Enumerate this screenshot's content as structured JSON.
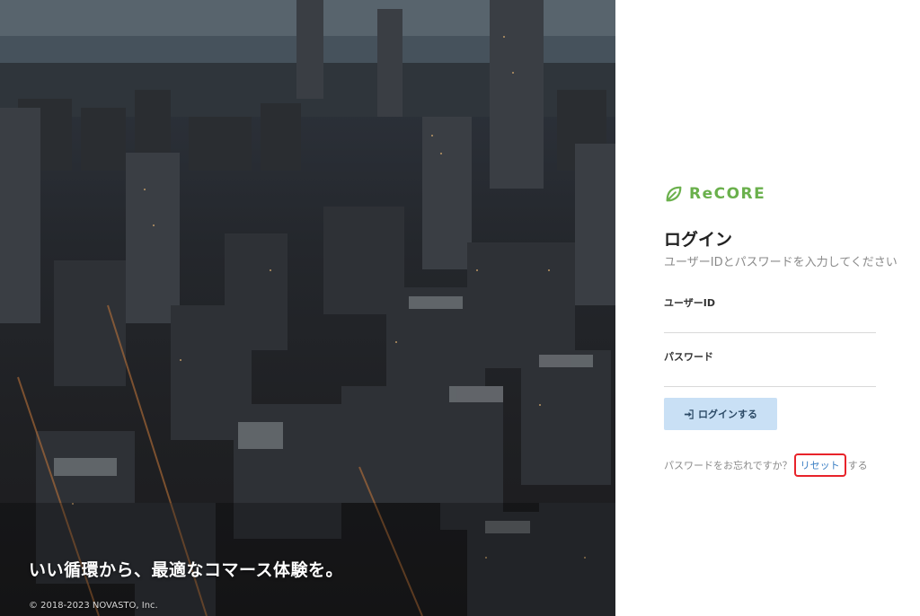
{
  "hero": {
    "tagline": "いい循環から、最適なコマース体験を。",
    "copyright": "© 2018-2023 NOVASTO, Inc."
  },
  "brand": {
    "name": "ReCORE",
    "logo_icon": "leaf-icon",
    "color": "#6ab04c"
  },
  "login": {
    "title": "ログイン",
    "subtitle": "ユーザーIDとパスワードを入力してください",
    "user_id_label": "ユーザーID",
    "user_id_value": "",
    "password_label": "パスワード",
    "password_value": "",
    "button_label": "ログインする",
    "button_icon": "sign-in-icon",
    "button_color": "#c9e0f5",
    "forgot_prefix": "パスワードをお忘れですか？",
    "reset_link": "リセット",
    "forgot_suffix": "する",
    "link_color": "#3b7fc4",
    "highlight_color": "#e8232a"
  }
}
